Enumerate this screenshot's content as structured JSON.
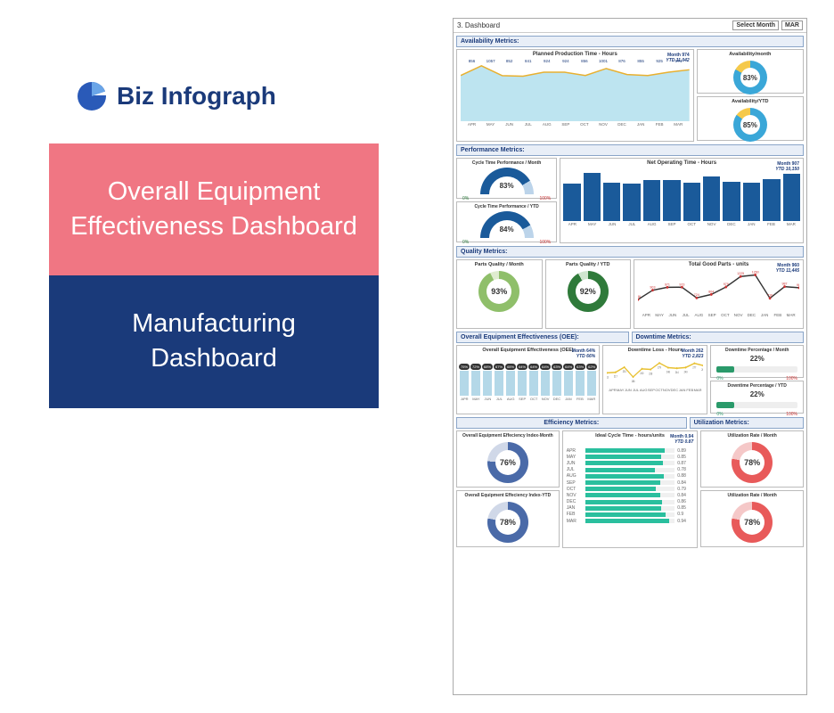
{
  "brand": {
    "name": "Biz Infograph"
  },
  "left": {
    "title1": "Overall Equipment Effectiveness Dashboard",
    "title2": "Manufacturing Dashboard"
  },
  "header": {
    "breadcrumb": "3. Dashboard",
    "select_label": "Select Month",
    "selected_month": "MAR"
  },
  "months": [
    "APR",
    "MAY",
    "JUN",
    "JUL",
    "AUG",
    "SEP",
    "OCT",
    "NOV",
    "DEC",
    "JAN",
    "FEB",
    "MAR"
  ],
  "availability": {
    "header": "Availability Metrics:",
    "chart_title": "Planned Production Time - Hours",
    "month_stat": "Month 974",
    "ytd_stat": "YTD 11,042",
    "donut_month": {
      "title": "Availability/month",
      "value": "83%",
      "pct": 83,
      "colors": {
        "fill": "#3aa7d8",
        "rest": "#f5c94a"
      }
    },
    "donut_ytd": {
      "title": "Availability/YTD",
      "value": "85%",
      "pct": 85,
      "colors": {
        "fill": "#3aa7d8",
        "rest": "#f5c94a"
      }
    }
  },
  "performance": {
    "header": "Performance Metrics:",
    "gauge_month": {
      "title": "Cycle Time Performance / Month",
      "value": "83%",
      "pct": 83
    },
    "gauge_ytd": {
      "title": "Cycle Time Performance / YTD",
      "value": "84%",
      "pct": 84
    },
    "bar_title": "Net Operating Time - Hours",
    "month_stat": "Month 907",
    "ytd_stat": "YTD 10,150"
  },
  "quality": {
    "header": "Quality Metrics:",
    "donut_month": {
      "title": "Parts Quality / Month",
      "value": "93%",
      "pct": 93,
      "colors": {
        "fill": "#8fbf6a",
        "rest": "#dfeccf"
      }
    },
    "donut_ytd": {
      "title": "Parts Quality / YTD",
      "value": "92%",
      "pct": 92,
      "colors": {
        "fill": "#2f7a3a",
        "rest": "#cfe6cf"
      }
    },
    "line_title": "Total Good Parts - units",
    "month_stat": "Month 960",
    "ytd_stat": "YTD 11,445"
  },
  "oee": {
    "header": "Overall Equipment Effectiveness (OEE):",
    "panel_title": "Overall Equipment Effectiveness (OEE)",
    "month_stat": "Month 64%",
    "ytd_stat": "YTD 66%",
    "values": [
      75,
      72,
      68,
      67,
      65,
      64,
      64,
      64,
      63,
      64,
      63,
      62
    ]
  },
  "downtime": {
    "header": "Downtime Metrics:",
    "line_title": "Downtime Loss - Hours",
    "month_stat": "Month 262",
    "ytd_stat": "YTD 2,823",
    "prog_month": {
      "title": "Downtime Percentage / Month",
      "value": "22%",
      "pct": 22
    },
    "prog_ytd": {
      "title": "Downtime Percentage / YTD",
      "value": "22%",
      "pct": 22
    }
  },
  "efficiency": {
    "header": "Efficiency Metrics:",
    "donut_month": {
      "title": "Overall Equipment Effeciency Index-Month",
      "value": "76%",
      "pct": 76,
      "colors": {
        "fill": "#4a6aa8",
        "rest": "#d0d8e8"
      }
    },
    "donut_ytd": {
      "title": "Overall Equipment Effeciency Index-YTD",
      "value": "78%",
      "pct": 78,
      "colors": {
        "fill": "#4a6aa8",
        "rest": "#d0d8e8"
      }
    },
    "ideal_title": "Ideal Cycle Time - hours/units",
    "ideal_month": "Month 0.94",
    "ideal_ytd": "YTD 0.87",
    "ideal": [
      {
        "m": "APR",
        "v": 0.89
      },
      {
        "m": "MAY",
        "v": 0.85
      },
      {
        "m": "JUN",
        "v": 0.87
      },
      {
        "m": "JUL",
        "v": 0.78
      },
      {
        "m": "AUG",
        "v": 0.88
      },
      {
        "m": "SEP",
        "v": 0.84
      },
      {
        "m": "OCT",
        "v": 0.79
      },
      {
        "m": "NOV",
        "v": 0.84
      },
      {
        "m": "DEC",
        "v": 0.86
      },
      {
        "m": "JAN",
        "v": 0.85
      },
      {
        "m": "FEB",
        "v": 0.9
      },
      {
        "m": "MAR",
        "v": 0.94
      }
    ]
  },
  "utilization": {
    "header": "Utilization Metrics:",
    "donut_month": {
      "title": "Utilization Rate / Month",
      "value": "78%",
      "pct": 78,
      "colors": {
        "fill": "#e85a5a",
        "rest": "#f5c8c8"
      }
    },
    "donut_ytd": {
      "title": "Utilization Rate / Month",
      "value": "78%",
      "pct": 78,
      "colors": {
        "fill": "#e85a5a",
        "rest": "#f5c8c8"
      }
    }
  },
  "chart_data": [
    {
      "type": "area",
      "title": "Planned Production Time - Hours",
      "categories": [
        "APR",
        "MAY",
        "JUN",
        "JUL",
        "AUG",
        "SEP",
        "OCT",
        "NOV",
        "DEC",
        "JAN",
        "FEB",
        "MAR"
      ],
      "values": [
        856,
        1057,
        852,
        841,
        924,
        924,
        856,
        1001,
        876,
        855,
        925,
        974
      ],
      "ylim": [
        0,
        1100
      ]
    },
    {
      "type": "bar",
      "title": "Net Operating Time - Hours",
      "categories": [
        "APR",
        "MAY",
        "JUN",
        "JUL",
        "AUG",
        "SEP",
        "OCT",
        "NOV",
        "DEC",
        "JAN",
        "FEB",
        "MAR"
      ],
      "values": [
        720,
        930,
        740,
        730,
        800,
        800,
        740,
        870,
        760,
        740,
        810,
        907
      ],
      "ylim": [
        0,
        1000
      ]
    },
    {
      "type": "line",
      "title": "Total Good Parts - units",
      "categories": [
        "APR",
        "MAY",
        "JUN",
        "JUL",
        "AUB",
        "SEP",
        "OCT",
        "NOV",
        "DEC",
        "JAN",
        "FEB",
        "MAR"
      ],
      "values": [
        686,
        903,
        971,
        973,
        724,
        804,
        979,
        1225,
        1260,
        716,
        987,
        960
      ],
      "ylim": [
        500,
        1300
      ]
    },
    {
      "type": "bar",
      "title": "Overall Equipment Effectiveness (OEE) %",
      "categories": [
        "APR",
        "MAY",
        "JUN",
        "JUL",
        "AUG",
        "SEP",
        "OCT",
        "NOV",
        "DEC",
        "JAN",
        "FEB",
        "MAR"
      ],
      "values": [
        75,
        72,
        68,
        67,
        65,
        64,
        64,
        64,
        63,
        64,
        63,
        62
      ],
      "ylim": [
        0,
        100
      ]
    },
    {
      "type": "line",
      "title": "Downtime Loss - Hours",
      "categories": [
        "APR",
        "MAY",
        "JUN",
        "JUL",
        "AUG",
        "SEP",
        "OCT",
        "NOV",
        "DEC",
        "JAN",
        "FEB",
        "MAR"
      ],
      "values": [
        213,
        217,
        251,
        186,
        240,
        236,
        279,
        248,
        244,
        249,
        277,
        262
      ],
      "ylim": [
        150,
        300
      ]
    },
    {
      "type": "bar",
      "title": "Ideal Cycle Time - hours/units",
      "categories": [
        "APR",
        "MAY",
        "JUN",
        "JUL",
        "AUG",
        "SEP",
        "OCT",
        "NOV",
        "DEC",
        "JAN",
        "FEB",
        "MAR"
      ],
      "values": [
        0.89,
        0.85,
        0.87,
        0.78,
        0.88,
        0.84,
        0.79,
        0.84,
        0.86,
        0.85,
        0.9,
        0.94
      ],
      "xlim": [
        0,
        1
      ]
    }
  ]
}
